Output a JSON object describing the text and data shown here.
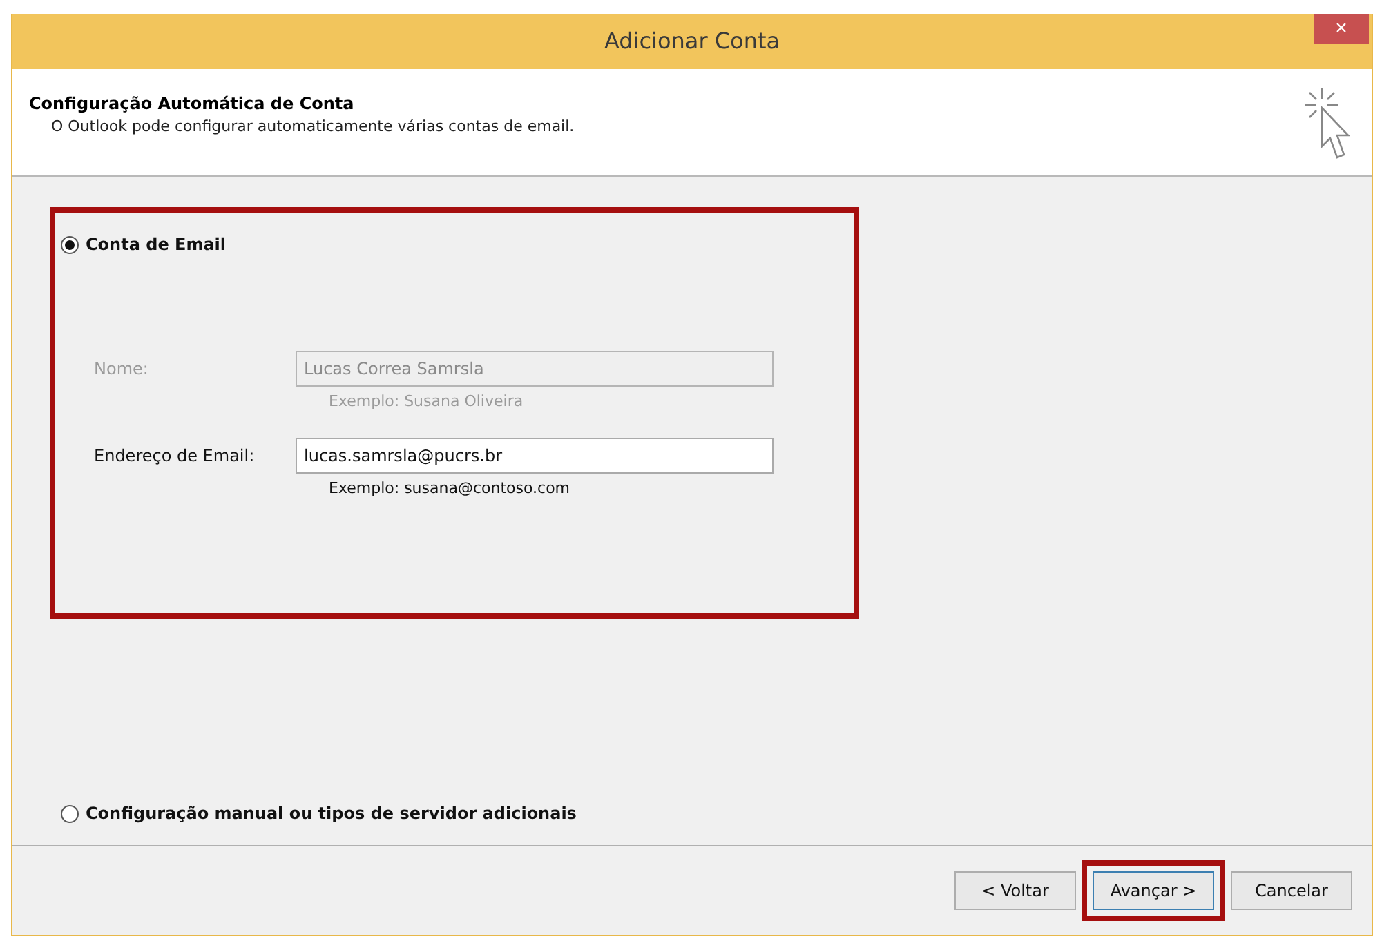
{
  "window": {
    "title": "Adicionar Conta",
    "close": "×"
  },
  "header": {
    "title": "Configuração Automática de Conta",
    "description": "O Outlook pode configurar automaticamente várias contas de email."
  },
  "email_section": {
    "highlighted": true
  },
  "options": [
    {
      "label": "Conta de Email",
      "selected": true
    },
    {
      "label": "Configuração manual ou tipos de servidor adicionais",
      "selected": false
    }
  ],
  "fields": [
    {
      "label": "Nome:",
      "value": "Lucas Correa Samrsla",
      "example": "Exemplo: Susana Oliveira",
      "disabled": true
    },
    {
      "label": "Endereço de Email:",
      "value": "lucas.samrsla@pucrs.br",
      "example": "Exemplo: susana@contoso.com",
      "disabled": false
    }
  ],
  "buttons": [
    {
      "label": "< Voltar",
      "highlighted": false,
      "focused": false
    },
    {
      "label": "Avançar >",
      "highlighted": true,
      "focused": true
    },
    {
      "label": "Cancelar",
      "highlighted": false,
      "focused": false
    }
  ]
}
